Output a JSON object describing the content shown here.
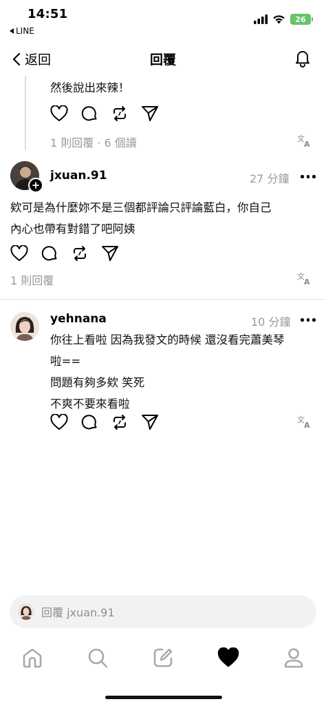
{
  "status_bar": {
    "time": "14:51",
    "back_app_label": "LINE",
    "battery": "26"
  },
  "nav": {
    "back_label": "返回",
    "title": "回覆"
  },
  "parent_post": {
    "text_tail": "然後說出來辣！",
    "meta": "1 則回覆 · 6 個讀"
  },
  "comments": [
    {
      "username": "jxuan.91",
      "time": "27 分鐘",
      "lines": [
        "欸可是為什麼妳不是三個都評論只評論藍白，你自己",
        "內心也帶有對錯了吧阿姨"
      ],
      "meta": "1 則回覆"
    },
    {
      "username": "yehnana",
      "time": "10 分鐘",
      "lines": [
        "你往上看啦 因為我發文的時候 還沒看完蕭美琴",
        "啦==",
        "問題有夠多欸 笑死",
        "不爽不要來看啦"
      ]
    }
  ],
  "reply_bar": {
    "placeholder": "回覆 jxuan.91"
  },
  "colors": {
    "muted": "#999999",
    "divider": "#e4e4e4",
    "battery": "#65c466",
    "reply_bg": "#f2f2f2"
  },
  "icons": {
    "actions": [
      "heart-icon",
      "comment-icon",
      "repost-icon",
      "share-icon",
      "translate-icon"
    ],
    "tabs": [
      "home-icon",
      "search-icon",
      "compose-icon",
      "activity-heart-icon",
      "profile-icon"
    ]
  }
}
